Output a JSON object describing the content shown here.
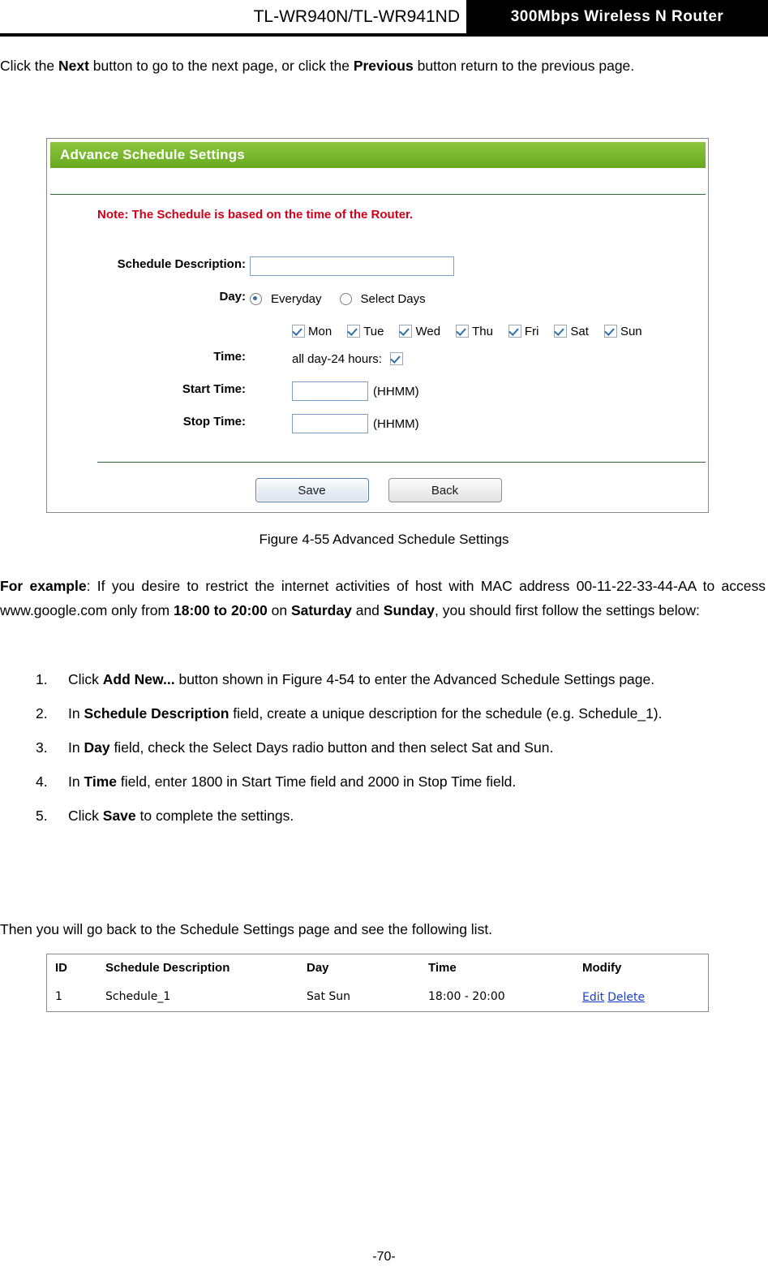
{
  "header": {
    "model": "TL-WR940N/TL-WR941ND",
    "product": "300Mbps Wireless N Router"
  },
  "intro_paragraph": {
    "part1": "Click the ",
    "bold1": "Next",
    "part2": " button to go to the next page, or click the ",
    "bold2": "Previous",
    "part3": " button return to the previous page."
  },
  "screenshot": {
    "title": "Advance Schedule Settings",
    "note": "Note: The Schedule is based on the time of the Router.",
    "labels": {
      "description": "Schedule Description:",
      "day": "Day:",
      "time": "Time:",
      "start_time": "Start Time:",
      "stop_time": "Stop Time:"
    },
    "description_value": "",
    "radio_everyday": "Everyday",
    "radio_select_days": "Select Days",
    "selected_radio": "Everyday",
    "days": [
      "Mon",
      "Tue",
      "Wed",
      "Thu",
      "Fri",
      "Sat",
      "Sun"
    ],
    "all_day_label": "all day-24 hours:",
    "start_time_value": "",
    "stop_time_value": "",
    "start_hint": "(HHMM)",
    "stop_hint": "(HHMM)",
    "buttons": {
      "save": "Save",
      "back": "Back"
    }
  },
  "figure_caption": "Figure 4-55    Advanced Schedule Settings",
  "example_paragraph": {
    "bold1": "For example",
    "part1": ": If you desire to restrict the internet activities of host with MAC address 00-11-22-33-44-AA to access www.google.com only from ",
    "bold2": "18:00 to 20:00",
    "part2": " on ",
    "bold3": "Saturday",
    "part3": " and ",
    "bold4": "Sunday",
    "part4": ", you should first follow the settings below:"
  },
  "steps": [
    {
      "num": "1.",
      "pre": "Click ",
      "bold": "Add New...",
      "post": " button shown in Figure 4-54 to enter the Advanced Schedule Settings page."
    },
    {
      "num": "2.",
      "pre": "In ",
      "bold": "Schedule Description",
      "post": " field, create a unique description for the schedule (e.g. Schedule_1)."
    },
    {
      "num": "3.",
      "pre": "In ",
      "bold": "Day",
      "post": " field, check the Select Days radio button and then select Sat and Sun."
    },
    {
      "num": "4.",
      "pre": "In ",
      "bold": "Time",
      "post": " field, enter 1800 in Start Time field and 2000 in Stop Time field."
    },
    {
      "num": "5.",
      "pre": "Click ",
      "bold": "Save",
      "post": " to complete the settings."
    }
  ],
  "then_paragraph": "Then you will go back to the Schedule Settings page and see the following list.",
  "result_table": {
    "headers": {
      "id": "ID",
      "description": "Schedule Description",
      "day": "Day",
      "time": "Time",
      "modify": "Modify"
    },
    "rows": [
      {
        "id": "1",
        "description": "Schedule_1",
        "day": "Sat  Sun",
        "time": "18:00 - 20:00",
        "edit": "Edit",
        "delete": "Delete"
      }
    ]
  },
  "footer": "-70-"
}
